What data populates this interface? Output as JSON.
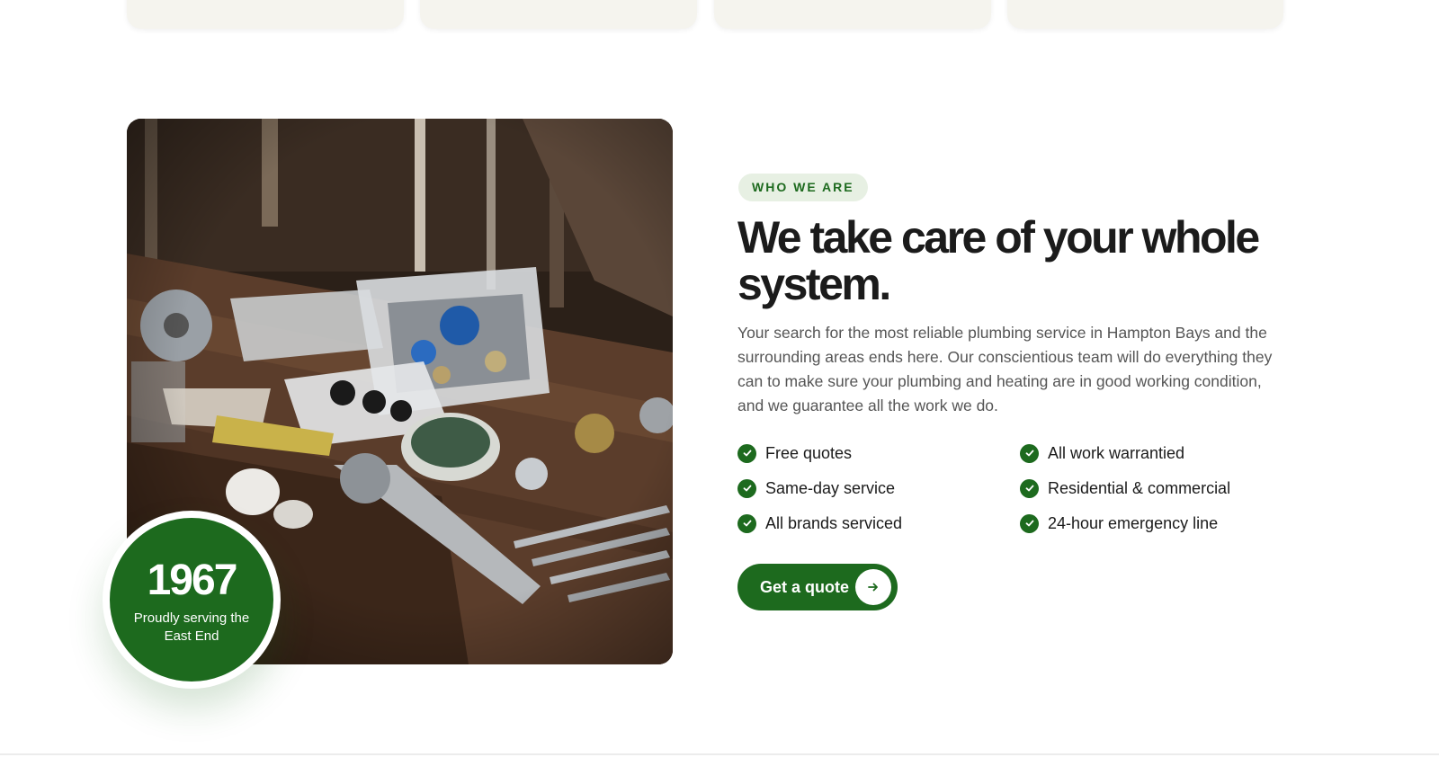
{
  "about": {
    "eyebrow": "WHO WE ARE",
    "headline": "We take care of your whole system.",
    "paragraph": "Your search for the most reliable plumbing service in Hampton Bays and the surrounding areas ends here. Our conscientious team will do everything they can to make sure your plumbing and heating are in good working condition, and we guarantee all the work we do.",
    "features": [
      {
        "label": "Free quotes",
        "icon": "check-icon"
      },
      {
        "label": "All work warrantied",
        "icon": "check-icon"
      },
      {
        "label": "Same-day service",
        "icon": "check-icon"
      },
      {
        "label": "Residential & commercial",
        "icon": "check-icon"
      },
      {
        "label": "All brands serviced",
        "icon": "check-icon"
      },
      {
        "label": "24-hour emergency line",
        "icon": "check-icon"
      }
    ],
    "cta": {
      "label": "Get a quote",
      "icon": "arrow-right-icon"
    }
  },
  "badge": {
    "year": "1967",
    "text": "Proudly serving the East End"
  },
  "image": {
    "subject": "plumbing-tools-photo"
  },
  "colors": {
    "brand_green": "#1d6a1e",
    "eyebrow_bg": "#e7f0e3",
    "card_bg": "#f5f4ee",
    "heading": "#1b1b1b",
    "body_text": "#555555"
  }
}
